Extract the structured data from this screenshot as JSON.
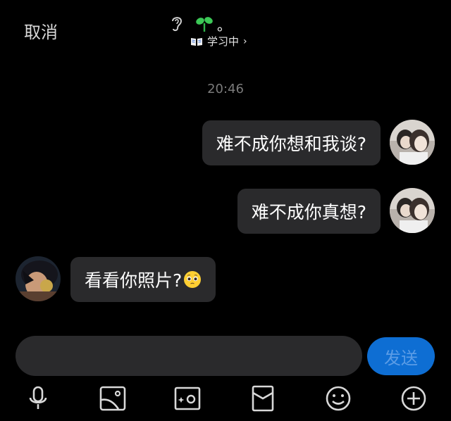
{
  "header": {
    "cancel_label": "取消",
    "name_suffix": "。",
    "status_label": "学习中",
    "status_chevron": "›",
    "icons": [
      "ear-icon",
      "sprout-icon",
      "book-icon"
    ]
  },
  "chat": {
    "timestamp": "20:46",
    "messages": [
      {
        "side": "right",
        "text": "难不成你想和我谈?"
      },
      {
        "side": "right",
        "text": "难不成你真想?"
      },
      {
        "side": "left",
        "text": "看看你照片?",
        "emoji": "pleading-face"
      }
    ]
  },
  "composer": {
    "input_value": "",
    "send_label": "发送"
  },
  "toolbar": {
    "items": [
      "microphone-icon",
      "image-icon",
      "camera-icon",
      "red-packet-icon",
      "smile-icon",
      "plus-icon"
    ]
  },
  "colors": {
    "background": "#000000",
    "bubble": "#2a2a2c",
    "send_button": "#0e6ed3",
    "send_text": "#5b9ce6",
    "timestamp": "#7b7b7b"
  }
}
